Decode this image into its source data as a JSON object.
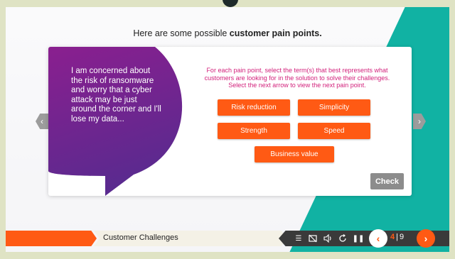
{
  "heading": {
    "prefix": "Here are some possible ",
    "bold": "customer pain points."
  },
  "bubble": {
    "quote": "I am concerned about the risk of ransomware and worry that a cyber attack may be just around the corner and I'll lose my data..."
  },
  "instruction": "For each pain point, select the term(s) that best represents what customers are looking for in the solution to solve their challenges. Select the next arrow to view the next pain point.",
  "options": {
    "risk": "Risk reduction",
    "simplicity": "Simplicity",
    "strength": "Strength",
    "speed": "Speed",
    "business": "Business value"
  },
  "check_label": "Check",
  "nav": {
    "prev_icon": "chevron-left-icon",
    "next_icon": "chevron-right-icon"
  },
  "bottom_bar": {
    "title": "Customer Challenges",
    "current_page": "4",
    "total_pages": "9",
    "icons": [
      "menu-icon",
      "captions-off-icon",
      "volume-icon",
      "replay-icon",
      "pause-icon"
    ]
  },
  "colors": {
    "accent_orange": "#ff5a14",
    "teal": "#11b2a3",
    "bubble_top": "#8a1f8f",
    "bubble_bottom": "#5a2a8f",
    "instruction": "#d21f7a"
  }
}
